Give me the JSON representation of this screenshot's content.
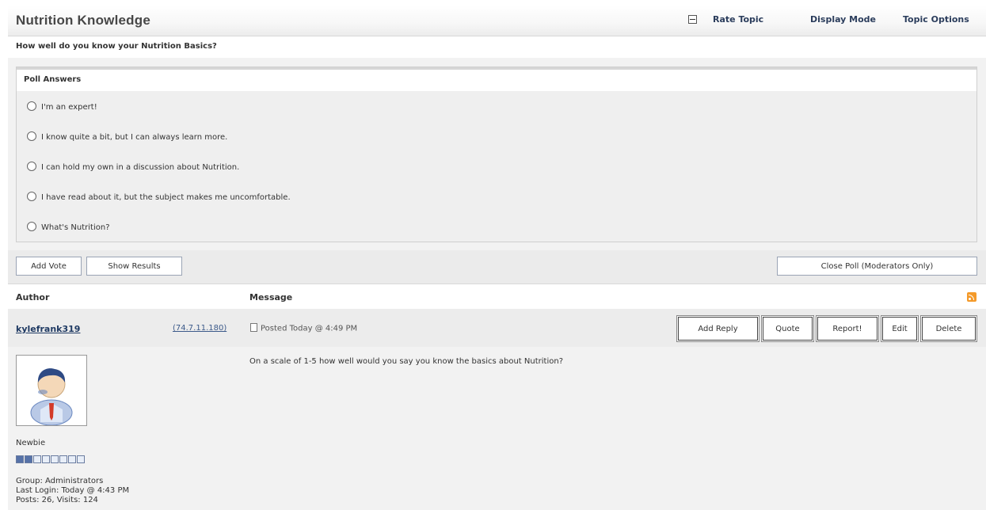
{
  "header": {
    "title": "Nutrition Knowledge",
    "collapse_icon": "minus-box-icon",
    "links": [
      "Rate Topic",
      "Display Mode",
      "Topic Options"
    ]
  },
  "poll": {
    "question": "How well do you know your Nutrition Basics?",
    "answers_title": "Poll Answers",
    "options": [
      "I'm an expert!",
      "I know quite a bit, but I can always learn more.",
      "I can hold my own in a discussion about Nutrition.",
      "I have read about it, but the subject makes me uncomfortable.",
      "What's Nutrition?"
    ],
    "add_vote_label": "Add Vote",
    "show_results_label": "Show Results",
    "close_poll_label": "Close Poll (Moderators Only)"
  },
  "columns": {
    "author": "Author",
    "message": "Message",
    "rss_icon": "rss-feed-icon"
  },
  "post": {
    "author": "kylefrank319",
    "ip": "(74.7.11.180)",
    "posted": "Posted Today @ 4:49 PM",
    "actions": [
      "Add Reply",
      "Quote",
      "Report!",
      "Edit",
      "Delete"
    ],
    "message": "On a scale of 1-5 how well would you say you know the basics about Nutrition?",
    "user": {
      "rank": "Newbie",
      "rank_level": 2,
      "rank_max": 8,
      "group": "Group: Administrators",
      "last_login": "Last Login: Today @ 4:43 PM",
      "posts_visits": "Posts: 26, Visits: 124"
    }
  },
  "colors": {
    "link_dark": "#2b3d5c",
    "author_link": "#1f3a63",
    "rank_pip_on": "#5672a8"
  }
}
